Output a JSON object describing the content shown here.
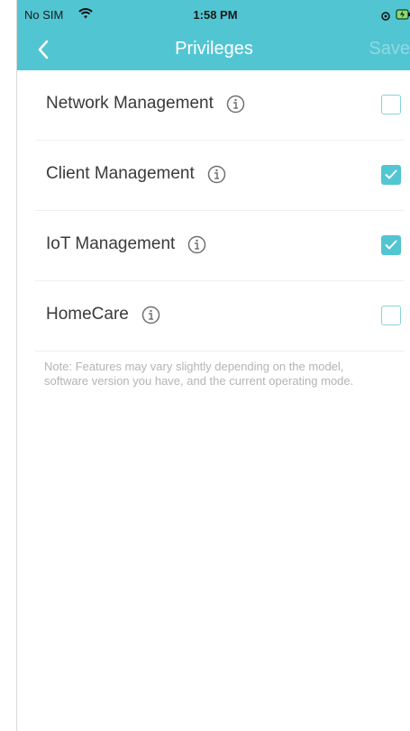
{
  "status_bar": {
    "carrier": "No SIM",
    "time": "1:58 PM",
    "wifi_icon": "wifi-icon",
    "location_icon": "location-icon",
    "battery_icon": "battery-charging-icon"
  },
  "header": {
    "title": "Privileges",
    "save_label": "Save",
    "back_icon": "chevron-left-icon"
  },
  "privileges": [
    {
      "label": "Network Management",
      "checked": false
    },
    {
      "label": "Client Management",
      "checked": true
    },
    {
      "label": "IoT Management",
      "checked": true
    },
    {
      "label": "HomeCare",
      "checked": false
    }
  ],
  "note": "Note: Features may vary slightly depending on the model, software version you have, and the current operating mode.",
  "colors": {
    "accent": "#52c5d3",
    "save_disabled": "#8fd9e2",
    "text": "#3a3a3a",
    "note_text": "#b4b4b4"
  }
}
